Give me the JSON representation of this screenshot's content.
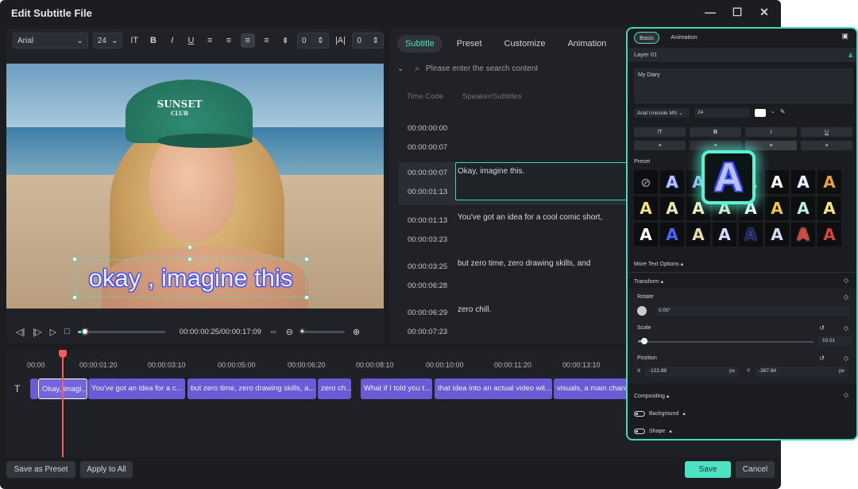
{
  "window": {
    "title": "Edit Subtitle File"
  },
  "toolbar": {
    "font": "Arial",
    "size": "24",
    "spacing": "0",
    "line_height": "0"
  },
  "video": {
    "cap_text_1": "SUNSET",
    "cap_text_2": "CLUB",
    "subtitle": "okay , imagine this"
  },
  "player": {
    "timecode": "00:00:00:25/00:00:17:09",
    "progress": 0.02
  },
  "tabs": [
    "Subtitle",
    "Preset",
    "Customize",
    "Animation"
  ],
  "search": {
    "placeholder": "Please enter the search content"
  },
  "table": {
    "headers": [
      "Time Code",
      "Speaker/Subtitles"
    ],
    "rows": [
      {
        "start": "00:00:00:00",
        "end": "00:00:00:07",
        "text": ""
      },
      {
        "start": "00:00:00:07",
        "end": "00:00:01:13",
        "text": "Okay, imagine this."
      },
      {
        "start": "00:00:01:13",
        "end": "00:00:03:23",
        "text": "You've got an idea for a cool comic short,"
      },
      {
        "start": "00:00:03:25",
        "end": "00:00:06:28",
        "text": "but zero time, zero drawing skills, and"
      },
      {
        "start": "00:00:06:29",
        "end": "00:00:07:23",
        "text": "zero chill."
      }
    ]
  },
  "timeline": {
    "ruler": [
      "00:00",
      "00:00:01:20",
      "00:00:03:10",
      "00:00:05:00",
      "00:00:06:20",
      "00:00:08:10",
      "00:00:10:00",
      "00:00:11:20",
      "00:00:13:10"
    ],
    "clips": [
      "Okay, imagi...",
      "You've got an idea for a c...",
      "but zero time, zero drawing skills, a...",
      "zero ch...",
      "What if I told you t...",
      "that idea into an actual video wit...",
      "visuals, a main chara"
    ]
  },
  "buttons": {
    "save_preset": "Save as Preset",
    "apply_all": "Apply to All",
    "save": "Save",
    "cancel": "Cancel"
  },
  "panel": {
    "tabs": [
      "Basic",
      "Animation"
    ],
    "layer": "Layer 01",
    "text_value": "My Diary",
    "font": "Arial Unicode MS",
    "size": "24",
    "preset_label": "Preset",
    "more_options": "More Text Options",
    "transform": "Transform",
    "rotate_label": "Rotate",
    "rotate_value": "0.00°",
    "scale_label": "Scale",
    "scale_value": "10.51",
    "position_label": "Position",
    "pos_x_label": "X",
    "pos_x": "-122.88",
    "pos_y_label": "Y",
    "pos_y": "-387.84",
    "unit": "px",
    "compositing": "Compositing",
    "background": "Background",
    "shape": "Shape"
  },
  "colors": {
    "accent": "#4be3c2",
    "clip": "#6b5bd6",
    "playhead": "#ff5a5a"
  }
}
